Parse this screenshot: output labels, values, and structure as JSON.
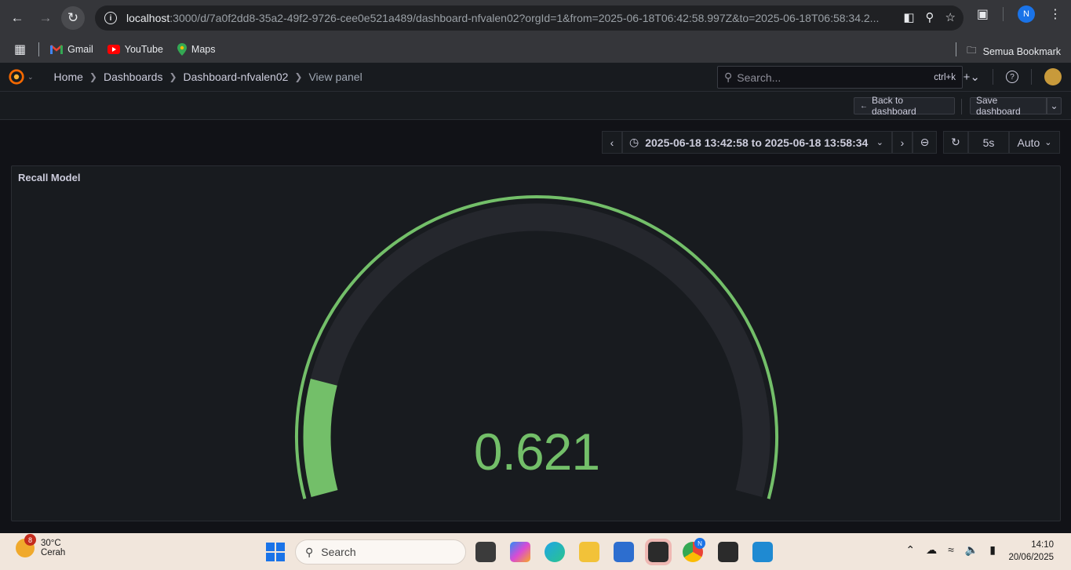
{
  "browser": {
    "url_host": "localhost",
    "url_rest": ":3000/d/7a0f2dd8-35a2-49f2-9726-cee0e521a489/dashboard-nfvalen02?orgId=1&from=2025-06-18T06:42:58.997Z&to=2025-06-18T06:58:34.2...",
    "profile_initial": "N",
    "bookmarks": [
      {
        "label": "Gmail",
        "icon": "gmail-icon"
      },
      {
        "label": "YouTube",
        "icon": "youtube-icon"
      },
      {
        "label": "Maps",
        "icon": "maps-icon"
      }
    ],
    "all_bookmarks_label": "Semua Bookmark"
  },
  "grafana": {
    "breadcrumb": [
      "Home",
      "Dashboards",
      "Dashboard-nfvalen02",
      "View panel"
    ],
    "search_placeholder": "Search...",
    "search_shortcut": "ctrl+k",
    "back_button": "Back to dashboard",
    "save_button": "Save dashboard",
    "time_range": "2025-06-18 13:42:58 to 2025-06-18 13:58:34",
    "refresh_interval": "5s",
    "auto_label": "Auto",
    "accent_color": "#73bf69"
  },
  "panel": {
    "title": "Recall Model",
    "type": "gauge",
    "value": 0.621,
    "value_text": "0.621",
    "min": 0,
    "max": 1,
    "threshold_color": "#73bf69"
  },
  "taskbar": {
    "temperature": "30°C",
    "condition": "Cerah",
    "weather_badge": "8",
    "search_label": "Search",
    "chrome_badge": "N",
    "time": "14:10",
    "date": "20/06/2025"
  }
}
